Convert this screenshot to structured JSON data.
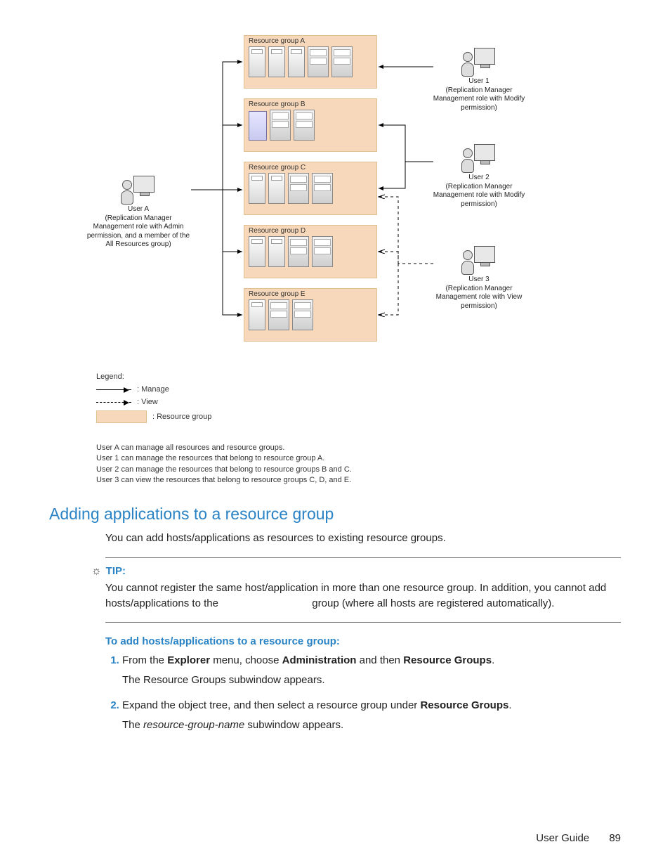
{
  "diagram": {
    "groups": [
      {
        "label": "Resource group A"
      },
      {
        "label": "Resource group B"
      },
      {
        "label": "Resource group C"
      },
      {
        "label": "Resource group D"
      },
      {
        "label": "Resource group E"
      }
    ],
    "userA": {
      "name": "User A",
      "desc": "(Replication Manager Management role with Admin permission, and a member of the All Resources group)"
    },
    "user1": {
      "name": "User 1",
      "desc": "(Replication Manager Management role with Modify permission)"
    },
    "user2": {
      "name": "User 2",
      "desc": "(Replication Manager Management role with Modify permission)"
    },
    "user3": {
      "name": "User 3",
      "desc": "(Replication Manager Management role with View permission)"
    },
    "legend": {
      "header": "Legend:",
      "manage": ": Manage",
      "view": ": View",
      "rgroup": ": Resource group"
    },
    "notes": [
      "User A can manage all resources and resource groups.",
      "User 1 can manage the resources that belong to resource group A.",
      "User 2 can manage the resources that belong to resource groups B and C.",
      "User 3 can view the resources that belong to resource groups C, D, and E."
    ]
  },
  "section_heading": "Adding applications to a resource group",
  "intro": "You can add hosts/applications as resources to existing resource groups.",
  "tip": {
    "label": "TIP:",
    "body_pre": "You cannot register the same host/application in more than one resource group. In addition, you cannot add hosts/applications to the ",
    "body_mid_gap": "                              ",
    "body_post": " group (where all hosts are registered automatically)."
  },
  "procedure_heading": "To add hosts/applications to a resource group:",
  "steps": {
    "s1a": "From the ",
    "s1b": "Explorer",
    "s1c": " menu, choose ",
    "s1d": "Administration",
    "s1e": " and then ",
    "s1f": "Resource Groups",
    "s1g": ".",
    "s1sub": "The Resource Groups subwindow appears.",
    "s2a": "Expand the object tree, and then select a resource group under ",
    "s2b": "Resource Groups",
    "s2c": ".",
    "s2sub_a": "The ",
    "s2sub_b": "resource-group-name",
    "s2sub_c": " subwindow appears."
  },
  "footer": {
    "title": "User Guide",
    "page": "89"
  }
}
